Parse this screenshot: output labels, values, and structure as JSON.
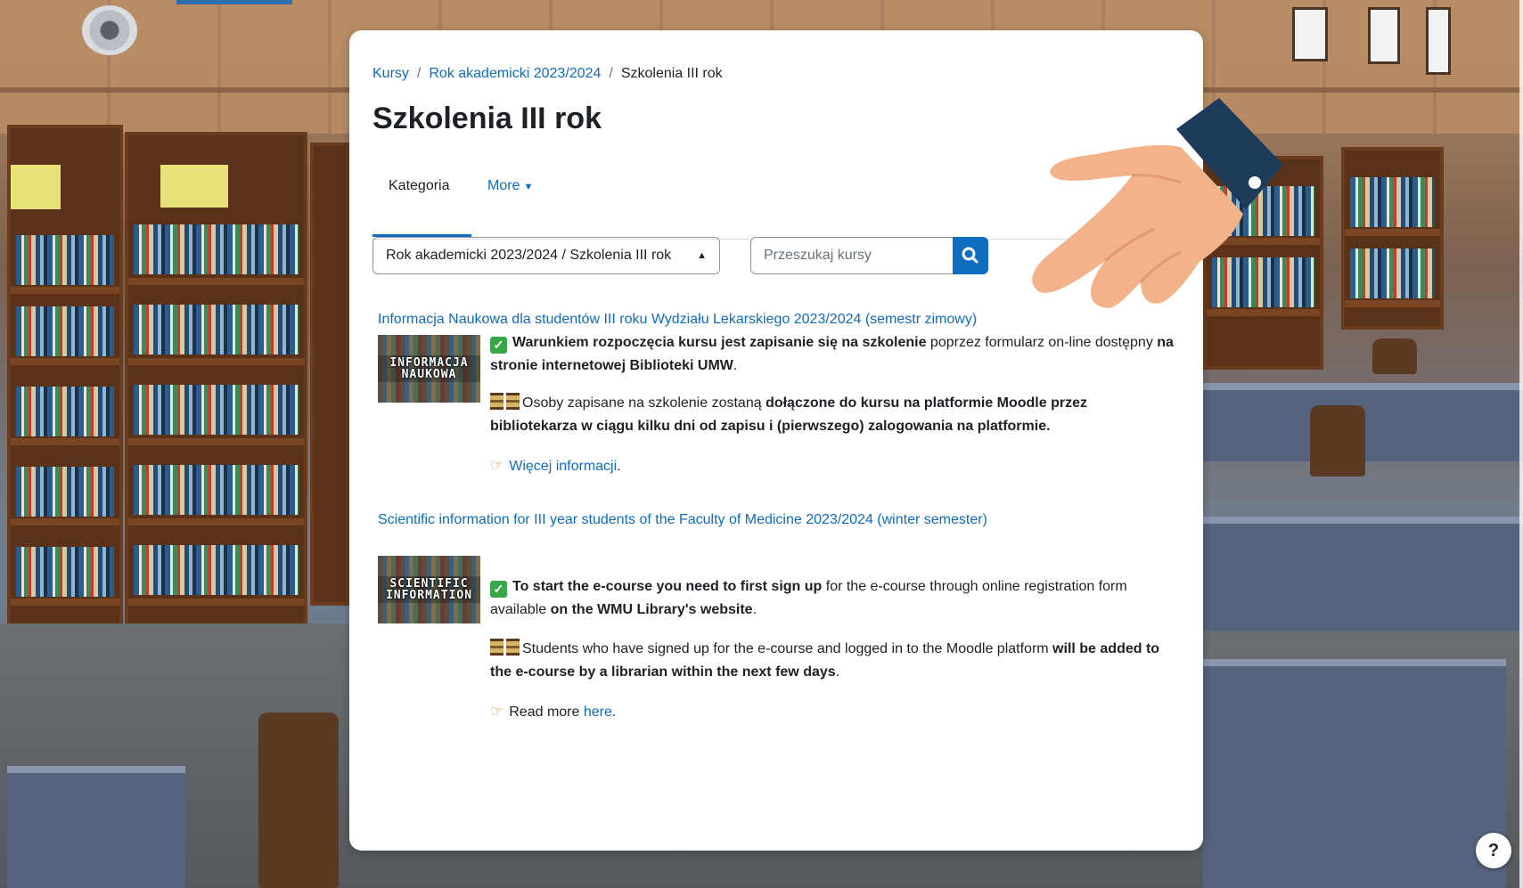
{
  "breadcrumb": {
    "items": [
      "Kursy",
      "Rok akademicki 2023/2024",
      "Szkolenia III rok"
    ]
  },
  "page": {
    "title": "Szkolenia III rok"
  },
  "tabs": {
    "active": "Kategoria",
    "more": "More"
  },
  "category_select": {
    "value": "Rok akademicki 2023/2024 / Szkolenia III rok"
  },
  "search": {
    "placeholder": "Przeszukaj kursy"
  },
  "courses": [
    {
      "title": "Informacja Naukowa dla studentów III roku Wydziału Lekarskiego 2023/2024 (semestr zimowy)",
      "thumb_text": [
        "INFORMACJA",
        "NAUKOWA"
      ],
      "p1_bold": "Warunkiem rozpoczęcia kursu jest zapisanie się na szkolenie",
      "p1_text": " poprzez formularz on-line dostępny ",
      "p1_bold2": "na stronie internetowej Biblioteki UMW",
      "p1_end": ".",
      "p2_text": "Osoby zapisane na szkolenie zostaną ",
      "p2_bold": "dołączone do kursu na platformie Moodle przez bibliotekarza w ciągu kilku dni od zapisu i (pierwszego) zalogowania na platformie.",
      "p3_link": "Więcej informacji",
      "p3_end": "."
    },
    {
      "title": "Scientific information for III year students of the Faculty of Medicine 2023/2024 (winter semester)",
      "thumb_text": [
        "SCIENTIFIC",
        "INFORMATION"
      ],
      "p1_bold": "To start the e-course you need to first sign up",
      "p1_text": " for the e-course through online registration form available ",
      "p1_bold2": "on the WMU Library's website",
      "p1_end": ".",
      "p2_text": "Students who have signed up for the e-course and logged in to the Moodle platform ",
      "p2_bold": "will be added to the e-course by a librarian within the next few days",
      "p2_end": ".",
      "p3_text": "Read more ",
      "p3_link": "here",
      "p3_end": "."
    }
  ],
  "help": {
    "label": "?"
  },
  "colors": {
    "link": "#0f6cbf",
    "text": "#1d2125",
    "accent": "#0f6cbf",
    "check": "#3aa64a"
  },
  "icons": [
    "search-icon",
    "chevron-down-icon",
    "select-arrows-icon",
    "check-mark-icon",
    "hourglass-icon",
    "pointing-hand-icon",
    "question-icon"
  ]
}
